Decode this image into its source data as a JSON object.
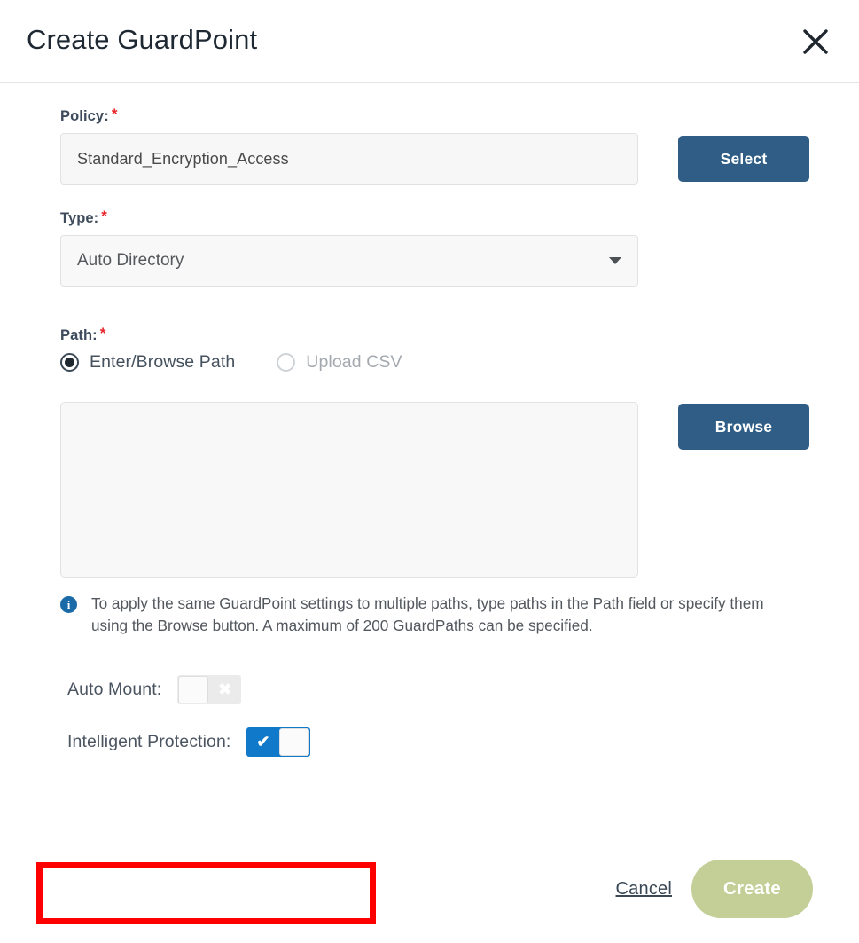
{
  "dialog": {
    "title": "Create GuardPoint",
    "close_icon": "close-icon"
  },
  "policy": {
    "label": "Policy:",
    "required_marker": "*",
    "value": "Standard_Encryption_Access",
    "select_button": "Select"
  },
  "type": {
    "label": "Type:",
    "required_marker": "*",
    "selected": "Auto Directory",
    "caret_icon": "chevron-down-icon"
  },
  "path": {
    "label": "Path:",
    "required_marker": "*",
    "options": [
      {
        "label": "Enter/Browse Path",
        "selected": true
      },
      {
        "label": "Upload CSV",
        "selected": false
      }
    ],
    "textarea_value": "",
    "textarea_placeholder": "",
    "browse_button": "Browse",
    "resize_grip_icon": "resize-grip-icon"
  },
  "info": {
    "icon": "info-circle-icon",
    "text": "To apply the same GuardPoint settings to multiple paths, type paths in the Path field or specify them using the Browse button. A maximum of 200 GuardPaths can be specified."
  },
  "toggles": {
    "auto_mount": {
      "label": "Auto Mount:",
      "state": "off",
      "glyph": "✖"
    },
    "intelligent_protection": {
      "label": "Intelligent Protection:",
      "state": "on",
      "glyph": "✔"
    }
  },
  "footer": {
    "cancel": "Cancel",
    "create": "Create"
  },
  "colors": {
    "primary_button": "#2f5d85",
    "create_button": "#c3cf97",
    "toggle_on": "#1179c9",
    "toggle_off": "#ebebeb",
    "required_star": "#e8252a",
    "highlight_border": "#fe0000",
    "info_icon": "#1a6aa8"
  }
}
